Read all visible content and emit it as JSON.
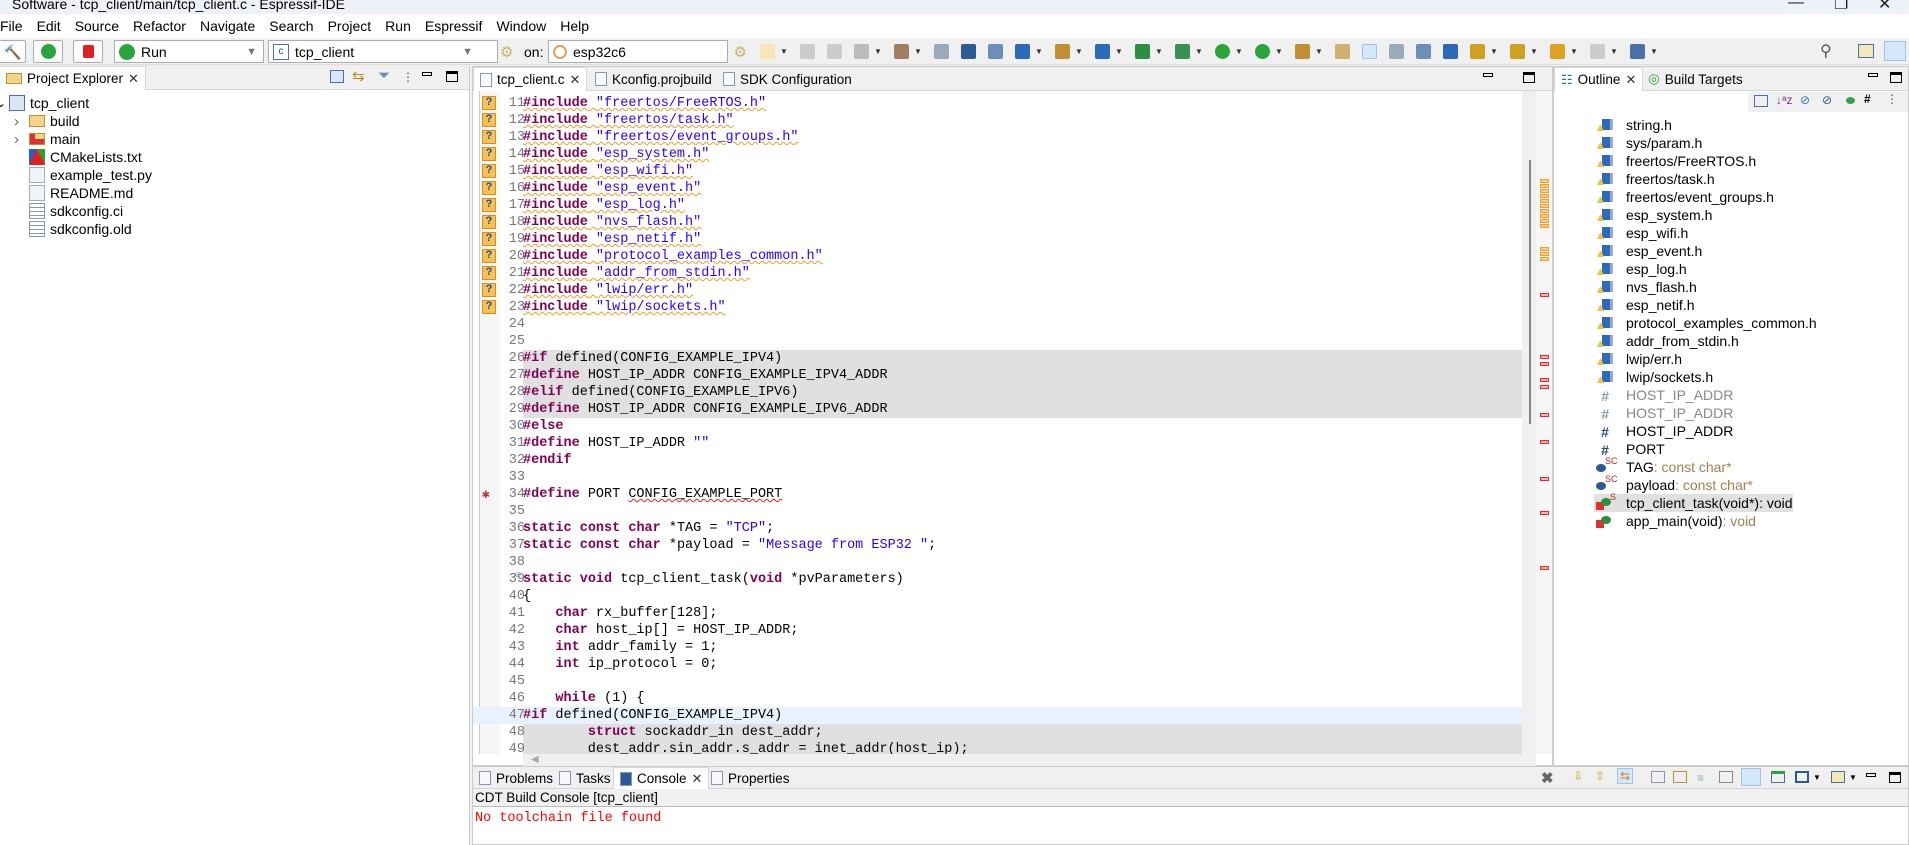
{
  "window": {
    "title": "Software - tcp_client/main/tcp_client.c - Espressif-IDE"
  },
  "menu": [
    "File",
    "Edit",
    "Source",
    "Refactor",
    "Navigate",
    "Search",
    "Project",
    "Run",
    "Espressif",
    "Window",
    "Help"
  ],
  "launchbar": {
    "mode": "Run",
    "config": "tcp_client",
    "on_label": "on:",
    "target": "esp32c6"
  },
  "toolbar_icons": [
    "new-icon",
    "save-icon",
    "save-all-icon",
    "settings-icon",
    "build-icon",
    "binary-icon",
    "terminal-icon",
    "link-icon",
    "new-class-icon",
    "new-source-folder-icon",
    "new-file-icon",
    "new-c-project-icon",
    "debug-icon",
    "run-icon",
    "external-tools-icon",
    "open-type-icon",
    "pen-icon",
    "highlight-icon",
    "toggle-block-icon",
    "show-whitespace-icon",
    "pilcrow-icon",
    "next-annotation-icon",
    "prev-annotation-icon",
    "back-icon",
    "forward-icon",
    "pin-editor-icon"
  ],
  "project_explorer": {
    "title": "Project Explorer",
    "items": [
      {
        "label": "tcp_client",
        "level": 0,
        "icon": "c-project-icon",
        "expanded": true
      },
      {
        "label": "build",
        "level": 1,
        "icon": "folder-icon"
      },
      {
        "label": "main",
        "level": 1,
        "icon": "folder-error-icon"
      },
      {
        "label": "CMakeLists.txt",
        "level": 1,
        "icon": "cmake-icon"
      },
      {
        "label": "example_test.py",
        "level": 1,
        "icon": "python-file-icon"
      },
      {
        "label": "README.md",
        "level": 1,
        "icon": "markdown-file-icon"
      },
      {
        "label": "sdkconfig.ci",
        "level": 1,
        "icon": "text-file-icon"
      },
      {
        "label": "sdkconfig.old",
        "level": 1,
        "icon": "text-file-icon"
      }
    ]
  },
  "editor": {
    "tabs": [
      {
        "label": "tcp_client.c",
        "active": true
      },
      {
        "label": "Kconfig.projbuild"
      },
      {
        "label": "SDK Configuration"
      }
    ],
    "lines": [
      {
        "n": "11",
        "text": "#include \"freertos/FreeRTOS.h\"",
        "marker": "unresolved-include"
      },
      {
        "n": "12",
        "text": "#include \"freertos/task.h\"",
        "marker": "unresolved-include"
      },
      {
        "n": "13",
        "text": "#include \"freertos/event_groups.h\"",
        "marker": "unresolved-include"
      },
      {
        "n": "14",
        "text": "#include \"esp_system.h\"",
        "marker": "unresolved-include"
      },
      {
        "n": "15",
        "text": "#include \"esp_wifi.h\"",
        "marker": "unresolved-include"
      },
      {
        "n": "16",
        "text": "#include \"esp_event.h\"",
        "marker": "unresolved-include"
      },
      {
        "n": "17",
        "text": "#include \"esp_log.h\"",
        "marker": "unresolved-include"
      },
      {
        "n": "18",
        "text": "#include \"nvs_flash.h\"",
        "marker": "unresolved-include"
      },
      {
        "n": "19",
        "text": "#include \"esp_netif.h\"",
        "marker": "unresolved-include"
      },
      {
        "n": "20",
        "text": "#include \"protocol_examples_common.h\"",
        "marker": "unresolved-include"
      },
      {
        "n": "21",
        "text": "#include \"addr_from_stdin.h\"",
        "marker": "unresolved-include"
      },
      {
        "n": "22",
        "text": "#include \"lwip/err.h\"",
        "marker": "unresolved-include"
      },
      {
        "n": "23",
        "text": "#include \"lwip/sockets.h\"",
        "marker": "unresolved-include"
      },
      {
        "n": "24",
        "text": ""
      },
      {
        "n": "25",
        "text": ""
      },
      {
        "n": "26",
        "text": "#if defined(CONFIG_EXAMPLE_IPV4)",
        "inactive": true
      },
      {
        "n": "27",
        "text": "#define HOST_IP_ADDR CONFIG_EXAMPLE_IPV4_ADDR",
        "inactive": true
      },
      {
        "n": "28",
        "text": "#elif defined(CONFIG_EXAMPLE_IPV6)",
        "inactive": true
      },
      {
        "n": "29",
        "text": "#define HOST_IP_ADDR CONFIG_EXAMPLE_IPV6_ADDR",
        "inactive": true
      },
      {
        "n": "30",
        "text": "#else"
      },
      {
        "n": "31",
        "text": "#define HOST_IP_ADDR \"\""
      },
      {
        "n": "32",
        "text": "#endif"
      },
      {
        "n": "33",
        "text": ""
      },
      {
        "n": "34",
        "text": "#define PORT CONFIG_EXAMPLE_PORT",
        "marker": "error"
      },
      {
        "n": "35",
        "text": ""
      },
      {
        "n": "36",
        "text": "static const char *TAG = \"TCP\";"
      },
      {
        "n": "37",
        "text": "static const char *payload = \"Message from ESP32 \";"
      },
      {
        "n": "38",
        "text": ""
      },
      {
        "n": "39",
        "text": "static void tcp_client_task(void *pvParameters)",
        "fold": true
      },
      {
        "n": "40",
        "text": "{"
      },
      {
        "n": "41",
        "text": "    char rx_buffer[128];"
      },
      {
        "n": "42",
        "text": "    char host_ip[] = HOST_IP_ADDR;"
      },
      {
        "n": "43",
        "text": "    int addr_family = 1;"
      },
      {
        "n": "44",
        "text": "    int ip_protocol = 0;"
      },
      {
        "n": "45",
        "text": ""
      },
      {
        "n": "46",
        "text": "    while (1) {"
      },
      {
        "n": "47",
        "text": "#if defined(CONFIG_EXAMPLE_IPV4)",
        "current": true
      },
      {
        "n": "48",
        "text": "        struct sockaddr_in dest_addr;",
        "inactive": true
      },
      {
        "n": "49",
        "text": "        dest_addr.sin_addr.s_addr = inet_addr(host_ip);",
        "inactive": true
      }
    ]
  },
  "outline": {
    "tabs": [
      {
        "label": "Outline",
        "active": true
      },
      {
        "label": "Build Targets"
      }
    ],
    "items": [
      {
        "label": "string.h",
        "kind": "include"
      },
      {
        "label": "sys/param.h",
        "kind": "include"
      },
      {
        "label": "freertos/FreeRTOS.h",
        "kind": "include"
      },
      {
        "label": "freertos/task.h",
        "kind": "include"
      },
      {
        "label": "freertos/event_groups.h",
        "kind": "include"
      },
      {
        "label": "esp_system.h",
        "kind": "include"
      },
      {
        "label": "esp_wifi.h",
        "kind": "include"
      },
      {
        "label": "esp_event.h",
        "kind": "include"
      },
      {
        "label": "esp_log.h",
        "kind": "include"
      },
      {
        "label": "nvs_flash.h",
        "kind": "include"
      },
      {
        "label": "esp_netif.h",
        "kind": "include"
      },
      {
        "label": "protocol_examples_common.h",
        "kind": "include"
      },
      {
        "label": "addr_from_stdin.h",
        "kind": "include"
      },
      {
        "label": "lwip/err.h",
        "kind": "include"
      },
      {
        "label": "lwip/sockets.h",
        "kind": "include"
      },
      {
        "label": "HOST_IP_ADDR",
        "kind": "macro-inactive"
      },
      {
        "label": "HOST_IP_ADDR",
        "kind": "macro-inactive"
      },
      {
        "label": "HOST_IP_ADDR",
        "kind": "macro"
      },
      {
        "label": "PORT",
        "kind": "macro"
      },
      {
        "label": "TAG",
        "type": " : const char*",
        "kind": "variable"
      },
      {
        "label": "payload",
        "type": " : const char*",
        "kind": "variable"
      },
      {
        "label": "tcp_client_task(void*)",
        "type": " : void",
        "kind": "function-static",
        "selected": true
      },
      {
        "label": "app_main(void)",
        "type": " : void",
        "kind": "function"
      }
    ]
  },
  "bottom": {
    "tabs": [
      {
        "label": "Problems"
      },
      {
        "label": "Tasks"
      },
      {
        "label": "Console",
        "active": true
      },
      {
        "label": "Properties"
      }
    ],
    "console_title": "CDT Build Console [tcp_client]",
    "console_output": "No toolchain file found",
    "error_color": "#ff0000"
  },
  "colors": {
    "keyword": "#7f0055",
    "string": "#2a00ff",
    "inactive_bg": "#e0e0e0",
    "current_line_bg": "#e8f2fe"
  }
}
